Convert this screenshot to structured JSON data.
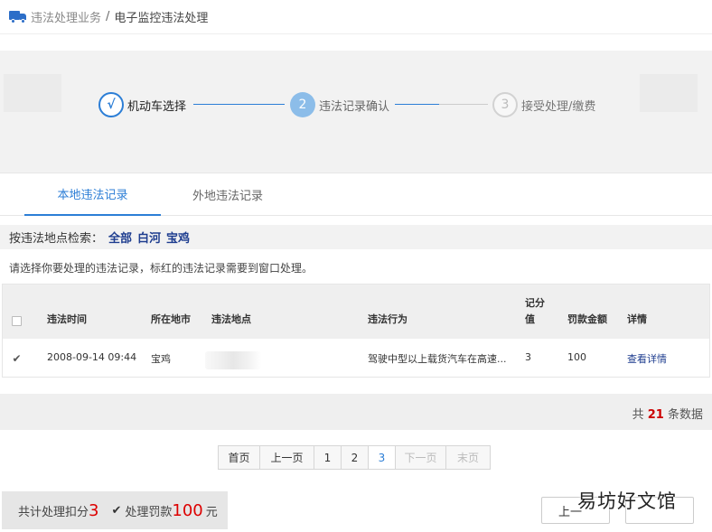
{
  "breadcrumb": {
    "icon": "truck-icon",
    "parent": "违法处理业务",
    "separator": "/",
    "current": "电子监控违法处理"
  },
  "steps": [
    {
      "marker": "√",
      "label": "机动车选择",
      "state": "done"
    },
    {
      "marker": "2",
      "label": "违法记录确认",
      "state": "current"
    },
    {
      "marker": "3",
      "label": "接受处理/缴费",
      "state": "pending"
    }
  ],
  "tabs": [
    {
      "label": "本地违法记录",
      "active": true
    },
    {
      "label": "外地违法记录",
      "active": false
    }
  ],
  "filter": {
    "label": "按违法地点检索：",
    "options": [
      "全部",
      "白河",
      "宝鸡"
    ]
  },
  "notice": "请选择你要处理的违法记录，标红的违法记录需要到窗口处理。",
  "table": {
    "headers": {
      "time": "违法时间",
      "city": "所在地市",
      "place": "违法地点",
      "action": "违法行为",
      "score_line1": "记分",
      "score_line2": "值",
      "fine": "罚款金额",
      "detail": "详情"
    },
    "rows": [
      {
        "checked": true,
        "time": "2008-09-14 09:44",
        "city": "宝鸡",
        "place": "",
        "action": "驾驶中型以上载货汽车在高速...",
        "score": "3",
        "fine": "100",
        "detail": "查看详情"
      }
    ]
  },
  "total": {
    "prefix": "共",
    "count": "21",
    "suffix": "条数据"
  },
  "pager": {
    "first": "首页",
    "prev": "上一页",
    "pages": [
      "1",
      "2",
      "3"
    ],
    "current_page": "3",
    "next": "下一页",
    "last": "末页"
  },
  "summary": {
    "score_label": "共计处理扣分",
    "score_value": "3",
    "fine_label": "处理罚款",
    "fine_value": "100",
    "fine_unit": "元"
  },
  "buttons": {
    "prev_label": "上一"
  },
  "watermark": "易坊好文馆",
  "colors": {
    "accent": "#2c7ed6",
    "link": "#1e3d8f",
    "highlight_red": "#d00"
  }
}
